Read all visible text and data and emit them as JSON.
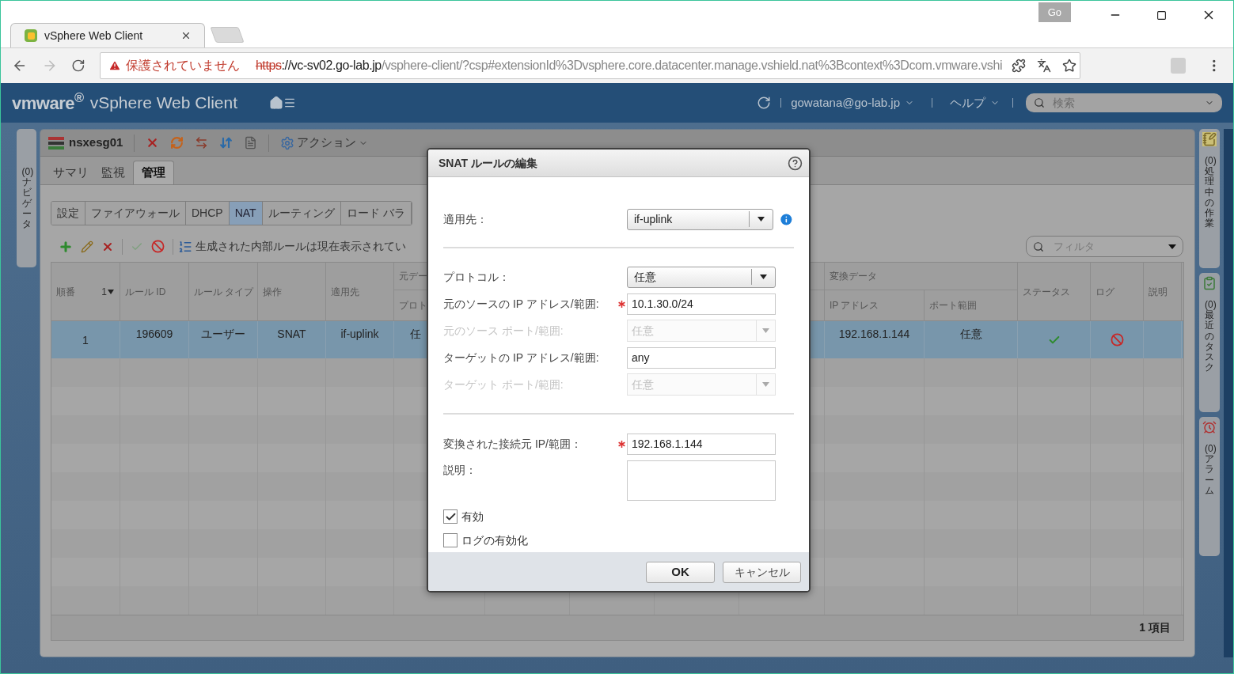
{
  "browser": {
    "tab": {
      "title": "vSphere Web Client"
    },
    "go_badge": "Go",
    "address": {
      "warning": "保護されていません",
      "scheme": "https",
      "host": "://vc-sv02.go-lab.jp",
      "path": "/vsphere-client/?csp#extensionId%3Dvsphere.core.datacenter.manage.vshield.nat%3Bcontext%3Dcom.vmware.vshi"
    }
  },
  "app_header": {
    "brand": "vmware$^{®}$",
    "product": "vSphere Web Client",
    "user": "gowatana@go-lab.jp",
    "help": "ヘルプ",
    "search": {
      "placeholder": "検索"
    }
  },
  "left_sidebar": [
    {
      "label": "(0) ナビゲータ"
    }
  ],
  "right_sidebar": [
    {
      "kind": "tasks",
      "label": "(0) 処理中の作業"
    },
    {
      "kind": "recent",
      "label": "(0) 最近のタスク"
    },
    {
      "kind": "alarms",
      "label": "(0) アラーム"
    }
  ],
  "object": {
    "name": "nsxesg01",
    "actions": "アクション",
    "tabs": [
      {
        "label": "サマリ",
        "selected": false
      },
      {
        "label": "監視",
        "selected": false
      },
      {
        "label": "管理",
        "selected": true
      }
    ],
    "subtabs": [
      {
        "label": "設定",
        "selected": false
      },
      {
        "label": "ファイアウォール",
        "selected": false
      },
      {
        "label": "DHCP",
        "selected": false
      },
      {
        "label": "NAT",
        "selected": true
      },
      {
        "label": "ルーティング",
        "selected": false
      },
      {
        "label": "ロード バラ",
        "selected": false
      }
    ]
  },
  "nat": {
    "note": "生成された内部ルールは現在表示されてい",
    "filter": {
      "placeholder": "フィルタ"
    },
    "table": {
      "columns": [
        {
          "label": "順番",
          "sort": "1"
        },
        {
          "label": "ルール ID"
        },
        {
          "label": "ルール タイプ"
        },
        {
          "label": "操作"
        },
        {
          "label": "適用先"
        },
        {
          "label": "元デー",
          "columns": [
            {
              "label": "プロト"
            },
            {},
            {},
            {},
            {}
          ]
        },
        {
          "label": "変換データ",
          "columns": [
            {
              "label": "IP アドレス"
            },
            {
              "label": "ポート範囲"
            }
          ]
        },
        {
          "label": "ステータス"
        },
        {
          "label": "ログ"
        },
        {
          "label": "説明"
        }
      ],
      "rows": [
        {
          "selected": true,
          "cells": [
            {
              "kind": "text",
              "text": "1"
            },
            {
              "kind": "text",
              "text": "196609"
            },
            {
              "kind": "text",
              "text": "ユーザー"
            },
            {
              "kind": "text",
              "text": "SNAT"
            },
            {
              "kind": "text",
              "text": "if-uplink"
            },
            {
              "kind": "text",
              "text": "任"
            },
            {
              "kind": "blank"
            },
            {
              "kind": "blank"
            },
            {
              "kind": "blank"
            },
            {
              "kind": "blank"
            },
            {
              "kind": "text",
              "text": "192.168.1.144"
            },
            {
              "kind": "text",
              "text": "任意"
            },
            {
              "kind": "status",
              "on": true
            },
            {
              "kind": "log",
              "on": false
            },
            {
              "kind": "blank"
            }
          ]
        }
      ]
    },
    "footer": "1 項目"
  },
  "dialog": {
    "title": "SNAT ルールの編集",
    "fields": [
      {
        "kind": "select",
        "label": "適用先：",
        "value": "if-uplink",
        "disabled": false,
        "info": true
      },
      {
        "kind": "divider"
      },
      {
        "kind": "select",
        "label": "プロトコル：",
        "value": "任意",
        "disabled": false
      },
      {
        "kind": "text",
        "label": "元のソースの IP アドレス/範囲:",
        "value": "10.1.30.0/24",
        "required": true
      },
      {
        "kind": "select",
        "label": "元のソース ポート/範囲:",
        "value": "任意",
        "disabled": true
      },
      {
        "kind": "text",
        "label": "ターゲットの IP アドレス/範囲:",
        "value": "any",
        "required": false
      },
      {
        "kind": "select",
        "label": "ターゲット ポート/範囲:",
        "value": "任意",
        "disabled": true
      },
      {
        "kind": "divider"
      },
      {
        "kind": "text",
        "label": "変換された接続元 IP/範囲：",
        "value": "192.168.1.144",
        "required": true
      },
      {
        "kind": "textarea",
        "label": "説明："
      },
      {
        "kind": "checkbox",
        "label": "有効",
        "checked": true
      },
      {
        "kind": "checkbox",
        "label": "ログの有効化",
        "checked": false
      }
    ],
    "buttons": [
      {
        "label": "OK",
        "primary": true
      },
      {
        "label": "キャンセル",
        "primary": false
      }
    ]
  }
}
